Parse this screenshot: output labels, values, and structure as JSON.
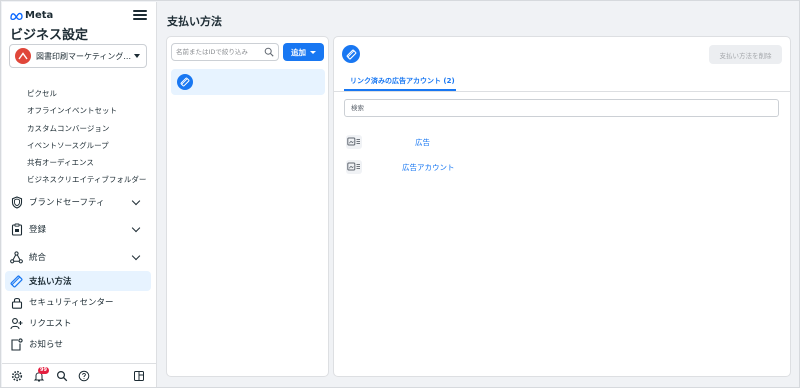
{
  "sidebar": {
    "brand": "Meta",
    "title": "ビジネス設定",
    "account": {
      "name": "図書印刷マーケティング..."
    },
    "sub_items": [
      "ピクセル",
      "オフラインイベントセット",
      "カスタムコンバージョン",
      "イベントソースグループ",
      "共有オーディエンス",
      "ビジネスクリエイティブフォルダー"
    ],
    "nav": {
      "brand_safety": "ブランドセーフティ",
      "registration": "登録",
      "integrations": "統合",
      "payment_methods": "支払い方法",
      "security_center": "セキュリティセンター",
      "requests": "リクエスト",
      "notifications": "お知らせ"
    },
    "notification_count": "99"
  },
  "page": {
    "title": "支払い方法"
  },
  "list": {
    "search_placeholder": "名前またはIDで絞り込み",
    "add_label": "追加"
  },
  "detail": {
    "delete_label": "支払い方法を削除",
    "tab_label": "リンク済みの広告アカウント (2)",
    "filter_placeholder": "検索",
    "rows": [
      "広告",
      "広告アカウント"
    ]
  },
  "colors": {
    "accent": "#1877f2",
    "active_bg": "#e7f3ff",
    "account_avatar": "#e0473a",
    "badge": "#e41e3f"
  }
}
